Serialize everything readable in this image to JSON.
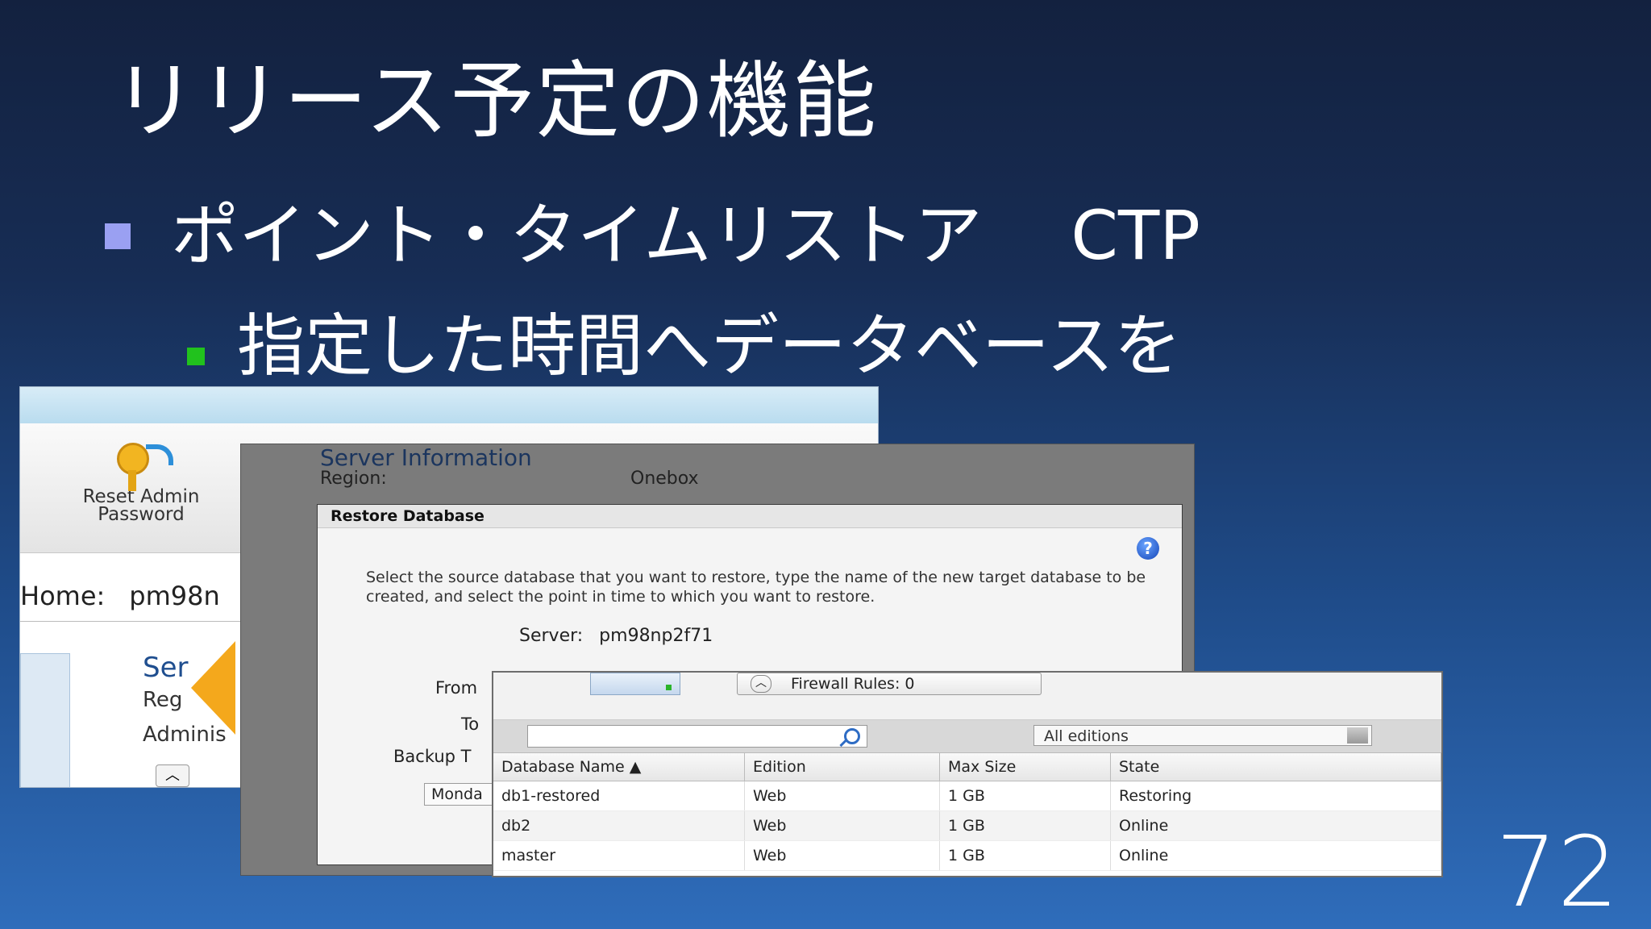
{
  "slide": {
    "title": "リリース予定の機能",
    "bullet1": "ポイント・タイムリストア",
    "bullet1_tag": "CTP",
    "bullet2": "指定した時間へデータベースを",
    "page_number": "72",
    "colors": {
      "bullet1_marker": "#9aa0f2",
      "bullet2_marker": "#21c21d"
    }
  },
  "back_window": {
    "reset_button_label": "Reset Admin Password",
    "home_label": "Home:",
    "home_value": "pm98n",
    "section_title": "Ser",
    "region_label": "Reg",
    "admin_label": "Adminis"
  },
  "dialog": {
    "server_info_title": "Server Information",
    "region_label": "Region:",
    "region_value": "Onebox",
    "title": "Restore Database",
    "help_icon": "?",
    "description": "Select the source database that you want to restore, type the name of the new target database to be created, and select the point in time to which you want to restore.",
    "server_label": "Server:",
    "server_value": "pm98np2f71",
    "from_label": "From",
    "to_label": "To",
    "backup_label": "Backup T",
    "monday_button": "Monda"
  },
  "database_list": {
    "firewall_button": "Firewall Rules: 0",
    "search_placeholder": "",
    "edition_filter": "All editions",
    "columns": [
      "Database Name ▲",
      "Edition",
      "Max Size",
      "State"
    ],
    "rows": [
      [
        "db1-restored",
        "Web",
        "1 GB",
        "Restoring"
      ],
      [
        "db2",
        "Web",
        "1 GB",
        "Online"
      ],
      [
        "master",
        "Web",
        "1 GB",
        "Online"
      ]
    ]
  }
}
